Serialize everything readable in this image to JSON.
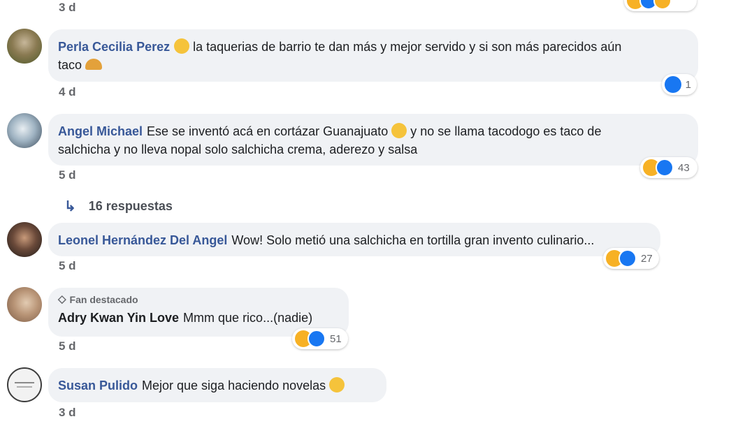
{
  "comments": [
    {
      "id": "c0",
      "time": "3 d",
      "partial": true
    },
    {
      "id": "c1",
      "author": "Perla Cecilia Perez",
      "text_a": "la taquerias de barrio te dan más y mejor servido y si son más parecidos aún",
      "text_b": "taco",
      "emoji_a": "slightly-smiling-emoji",
      "emoji_b": "taco-emoji",
      "time": "4 d",
      "reaction_count": "1",
      "reaction_icons": [
        "like-icon"
      ]
    },
    {
      "id": "c2",
      "author": "Angel Michael",
      "text_a": "Ese se inventó acá en cortázar Guanajuato",
      "text_b": "y no se llama tacodogo es taco de",
      "text_c": "salchicha y no lleva nopal solo salchicha crema, aderezo y salsa",
      "emoji_a": "sad-face-emoji",
      "time": "5 d",
      "reaction_count": "43",
      "reaction_icons": [
        "haha-icon",
        "like-icon"
      ],
      "replies_label": "16 respuestas"
    },
    {
      "id": "c3",
      "author": "Leonel Hernández Del Angel",
      "text_a": "Wow! Solo metió una salchicha en tortilla gran invento culinario...",
      "time": "5 d",
      "reaction_count": "27",
      "reaction_icons": [
        "haha-icon",
        "like-icon"
      ]
    },
    {
      "id": "c4",
      "badge": "Fan destacado",
      "author": "Adry Kwan Yin Love",
      "text_a": "Mmm que rico...(nadie)",
      "time": "5 d",
      "reaction_count": "51",
      "reaction_icons": [
        "haha-icon",
        "like-icon"
      ]
    },
    {
      "id": "c5",
      "author": "Susan Pulido",
      "text_a": "Mejor que siga haciendo novelas",
      "emoji_a": "grinning-face-emoji",
      "time": "3 d"
    }
  ],
  "colors": {
    "author": "#385898",
    "bubble_bg": "#f0f2f5",
    "meta": "#65676b",
    "like": "#1877f2",
    "haha": "#f7b125"
  }
}
